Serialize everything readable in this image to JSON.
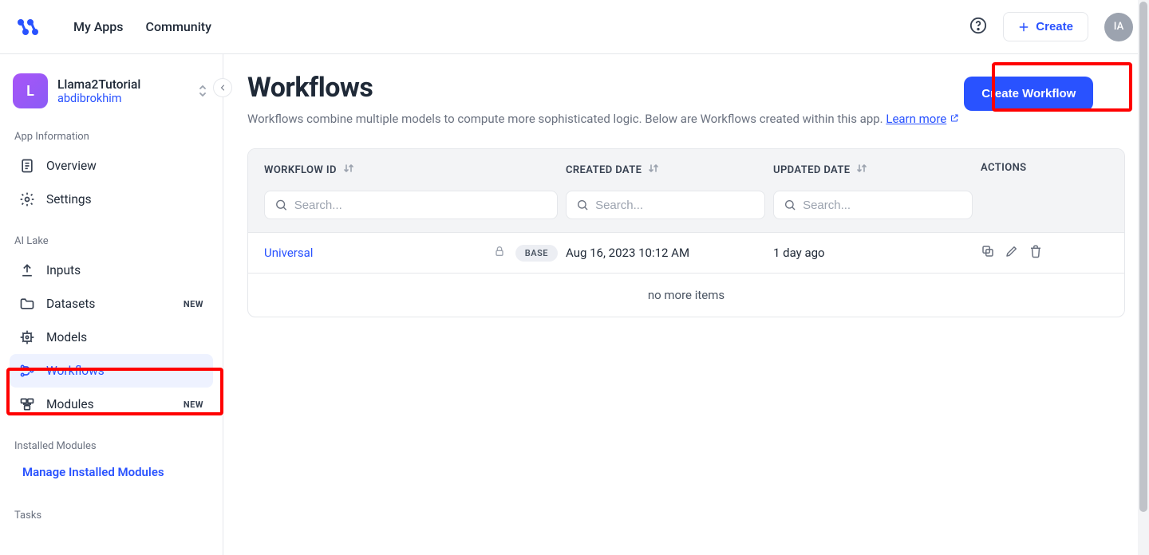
{
  "top": {
    "myapps": "My Apps",
    "community": "Community",
    "create": "Create",
    "avatar": "IA"
  },
  "app": {
    "initial": "L",
    "name": "Llama2Tutorial",
    "user": "abdibrokhim"
  },
  "sidebar": {
    "sec_info": "App Information",
    "overview": "Overview",
    "settings": "Settings",
    "sec_lake": "AI Lake",
    "inputs": "Inputs",
    "datasets": "Datasets",
    "models": "Models",
    "workflows": "Workflows",
    "modules": "Modules",
    "new": "NEW",
    "sec_installed": "Installed Modules",
    "manage": "Manage Installed Modules",
    "sec_tasks": "Tasks"
  },
  "page": {
    "title": "Workflows",
    "desc_a": "Workflows combine multiple models to compute more sophisticated logic. Below are Workflows created within this app. ",
    "learn": "Learn more",
    "create_workflow": "Create Workflow"
  },
  "table": {
    "h1": "WORKFLOW ID",
    "h2": "CREATED DATE",
    "h3": "UPDATED DATE",
    "h4": "ACTIONS",
    "search_ph": "Search...",
    "row": {
      "id": "Universal",
      "base": "BASE",
      "created": "Aug 16, 2023 10:12 AM",
      "updated": "1 day ago"
    },
    "no_more": "no more items"
  }
}
